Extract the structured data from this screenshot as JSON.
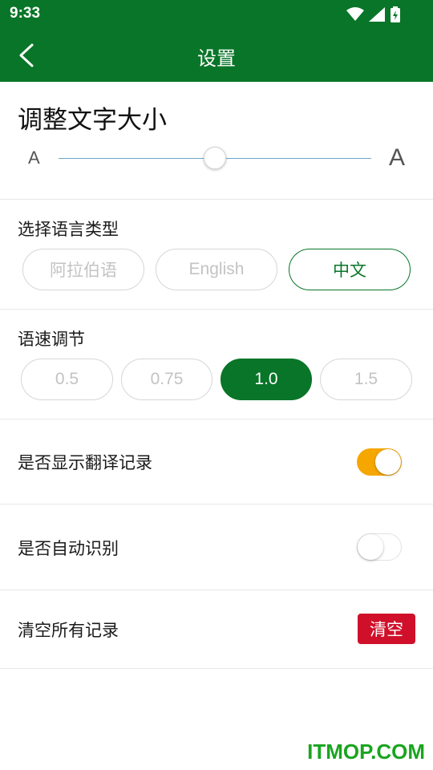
{
  "status_bar": {
    "time": "9:33"
  },
  "app_bar": {
    "title": "设置"
  },
  "font_size": {
    "heading": "调整文字大小",
    "small_a": "A",
    "large_a": "A",
    "level": 0.5
  },
  "language": {
    "label": "选择语言类型",
    "options": [
      "阿拉伯语",
      "English",
      "中文"
    ],
    "selected": "中文"
  },
  "speed": {
    "label": "语速调节",
    "options": [
      "0.5",
      "0.75",
      "1.0",
      "1.5"
    ],
    "selected": "1.0"
  },
  "show_history": {
    "label": "是否显示翻译记录",
    "enabled": true
  },
  "auto_detect": {
    "label": "是否自动识别",
    "enabled": false
  },
  "clear_records": {
    "label": "清空所有记录",
    "button": "清空"
  },
  "watermark": "ITMOP.COM",
  "colors": {
    "primary": "#087528",
    "toggle_on": "#f5a700",
    "danger": "#d0102a"
  }
}
